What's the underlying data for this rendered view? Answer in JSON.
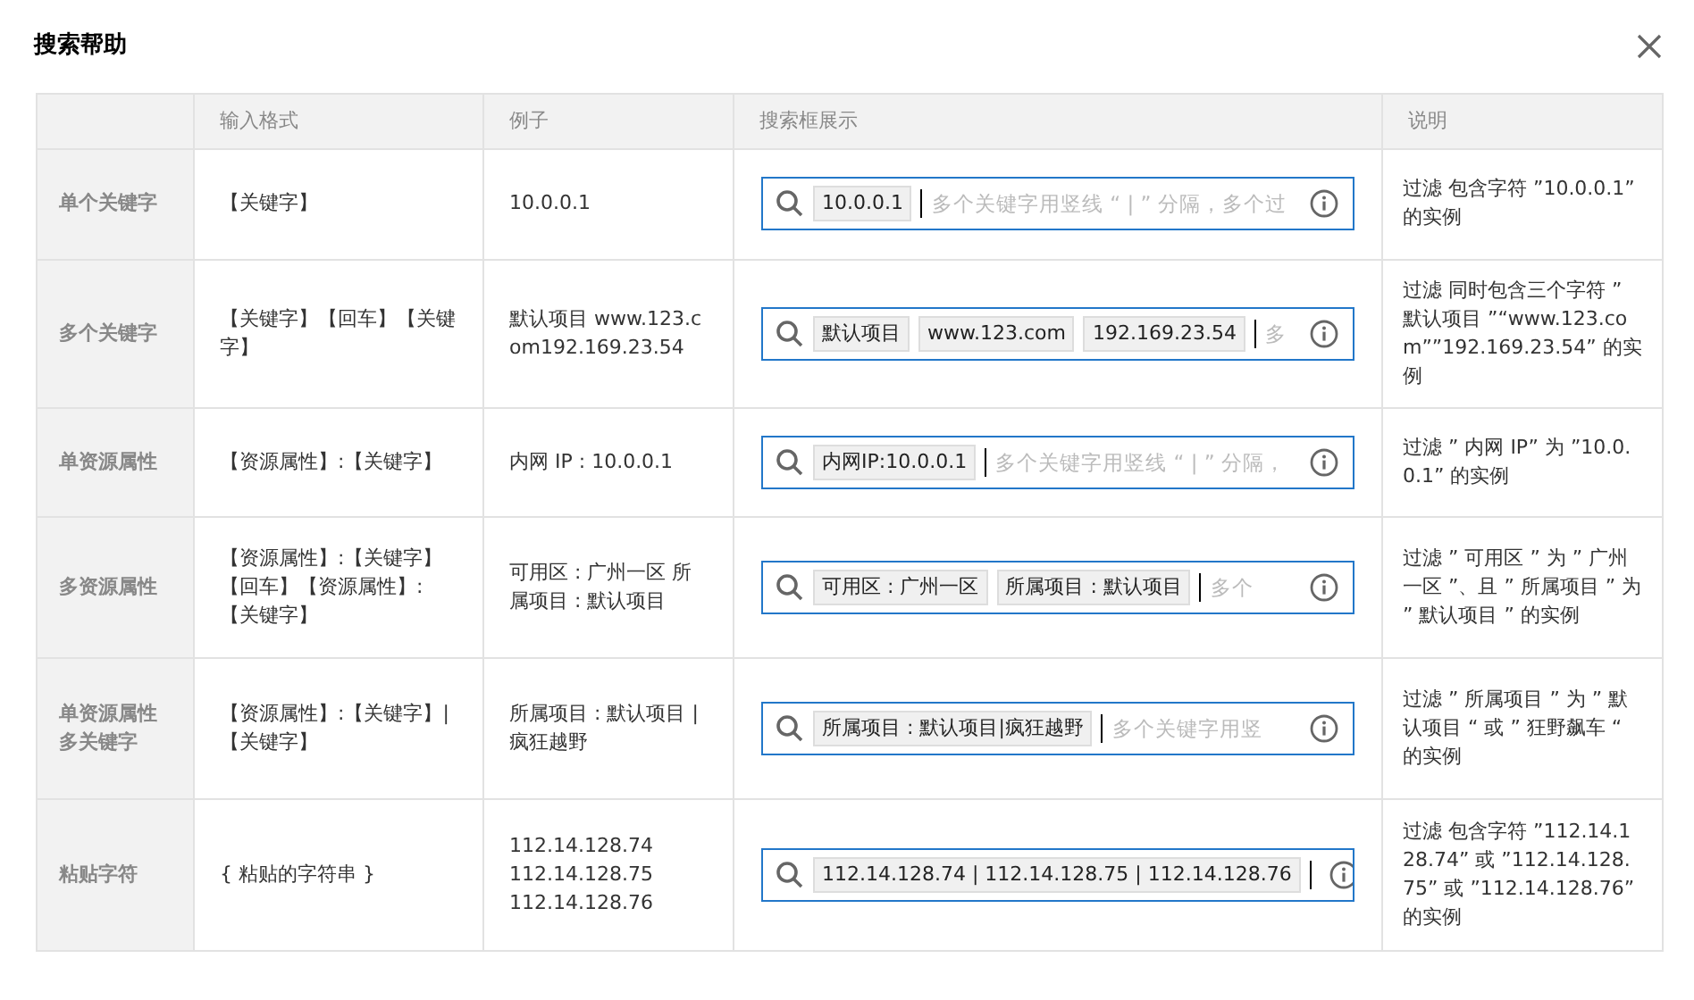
{
  "dialog": {
    "title": "搜索帮助"
  },
  "table": {
    "columns": [
      "输入格式",
      "例子",
      "搜索框展示",
      "说明"
    ],
    "rows": [
      {
        "name": "单个关键字",
        "format": "【关键字】",
        "example": [
          "10.0.0.1"
        ],
        "tags": [
          "10.0.0.1"
        ],
        "placeholder": "多个关键字用竖线 “ | ” 分隔，多个过",
        "description": "过滤 包含字符 ”10.0.0.1” 的实例"
      },
      {
        "name": "多个关键字",
        "format": "【关键字】【回车】【关键字】",
        "example": [
          "默认项目 www.123.com192.169.23.54"
        ],
        "tags": [
          "默认项目",
          "www.123.com",
          "192.169.23.54"
        ],
        "placeholder": "多",
        "description": "过滤 同时包含三个字符 ” 默认项目 ”“www.123.com””192.169.23.54” 的实例"
      },
      {
        "name": "单资源属性",
        "format": "【资源属性】:【关键字】",
        "example": [
          "内网 IP : 10.0.0.1"
        ],
        "tags": [
          "内网IP:10.0.0.1"
        ],
        "placeholder": "多个关键字用竖线 “ | ” 分隔，",
        "description": "过滤 ” 内网 IP” 为 ”10.0.0.1” 的实例"
      },
      {
        "name": "多资源属性",
        "format": "【资源属性】:【关键字】【回车】【资源属性】:【关键字】",
        "example": [
          "可用区 : 广州一区 所属项目 : 默认项目"
        ],
        "tags": [
          "可用区 : 广州一区",
          "所属项目 : 默认项目"
        ],
        "placeholder": "多个",
        "description": "过滤 ” 可用区 ” 为 ” 广州一区 ”、且 ” 所属项目 ” 为 ” 默认项目 ” 的实例"
      },
      {
        "name": "单资源属性多关键字",
        "format": "【资源属性】:【关键字】|【关键字】",
        "example": [
          "所属项目 : 默认项目 | 疯狂越野"
        ],
        "tags": [
          "所属项目 : 默认项目|疯狂越野"
        ],
        "placeholder": "多个关键字用竖",
        "description": "过滤 ” 所属项目 ” 为 ” 默认项目 “ 或 ” 狂野飙车 “ 的实例"
      },
      {
        "name": "粘贴字符",
        "format": "{ 粘贴的字符串 }",
        "example": [
          "112.14.128.74",
          "112.14.128.75",
          "112.14.128.76"
        ],
        "tags": [
          "112.14.128.74 | 112.14.128.75 | 112.14.128.76"
        ],
        "description": "过滤 包含字符 ”112.14.128.74” 或 ”112.14.128.75” 或 ”112.14.128.76” 的实例"
      }
    ]
  }
}
